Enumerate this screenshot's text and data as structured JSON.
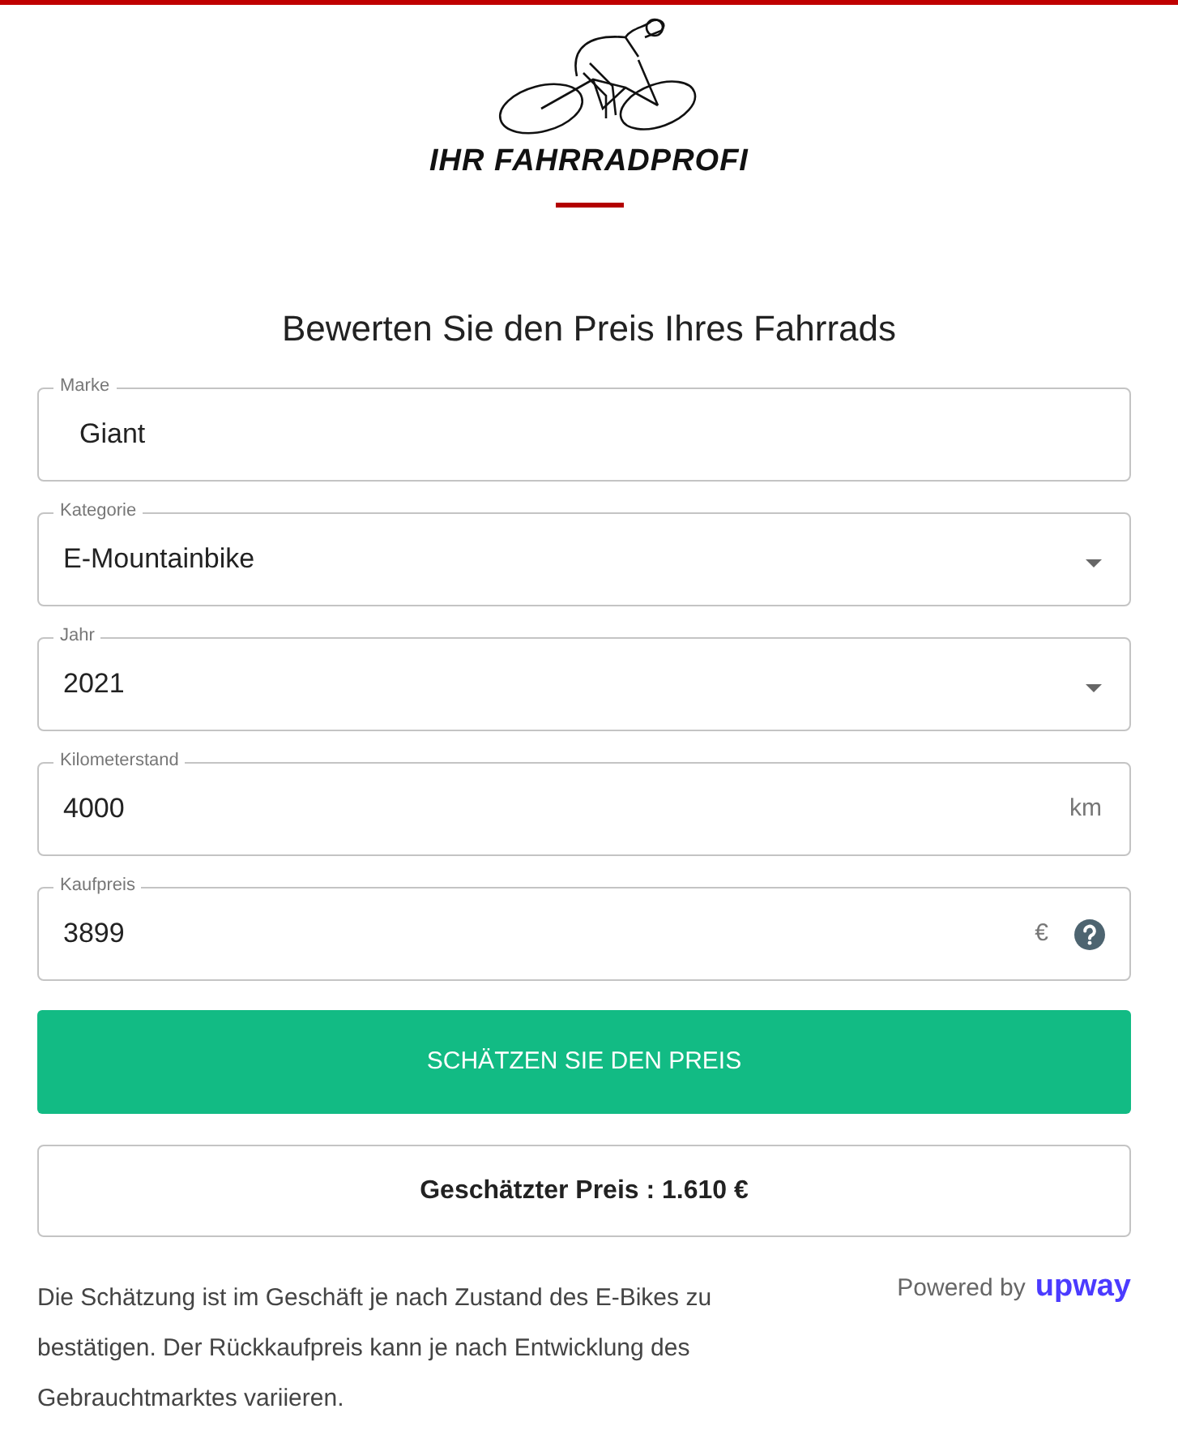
{
  "logo": {
    "text": "IHR FAHRRADPROFI"
  },
  "heading": "Bewerten Sie den Preis Ihres Fahrrads",
  "fields": [
    {
      "kind": "text",
      "label": "Marke",
      "value": "Giant"
    },
    {
      "kind": "select",
      "label": "Kategorie",
      "value": "E-Mountainbike"
    },
    {
      "kind": "select",
      "label": "Jahr",
      "value": "2021"
    },
    {
      "kind": "text",
      "label": "Kilometerstand",
      "value": "4000",
      "suffix": "km"
    },
    {
      "kind": "text",
      "label": "Kaufpreis",
      "value": "3899",
      "suffix": "€",
      "help": true
    }
  ],
  "submit_button": "SCHÄTZEN SIE DEN PREIS",
  "result": "Geschätzter Preis : 1.610 €",
  "disclaimer": "Die Schätzung ist im Geschäft je nach Zustand des E-Bikes zu bestätigen. Der Rückkaufpreis kann je nach Entwicklung des Gebrauchtmarktes variieren.",
  "powered_by": {
    "text": "Powered by",
    "brand": "upway"
  }
}
